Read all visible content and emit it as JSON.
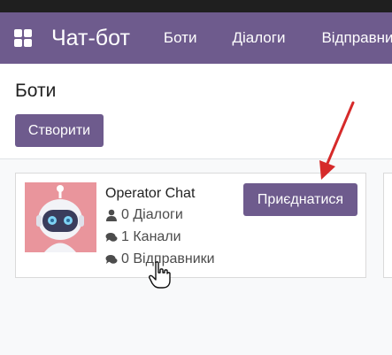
{
  "navbar": {
    "brand": "Чат-бот",
    "menu": [
      "Боти",
      "Діалоги",
      "Відправники"
    ]
  },
  "control": {
    "title": "Боти",
    "create_label": "Створити"
  },
  "card": {
    "name": "Operator Chat",
    "stats": [
      {
        "icon": "user-icon",
        "text": "0 Діалоги"
      },
      {
        "icon": "comments-icon",
        "text": "1 Канали"
      },
      {
        "icon": "comments-icon",
        "text": "0 Відправники"
      }
    ],
    "join_label": "Приєднатися"
  },
  "colors": {
    "primary": "#6e5b8d",
    "avatar_bg": "#e9959c",
    "annotation_arrow": "#d62a2a"
  }
}
